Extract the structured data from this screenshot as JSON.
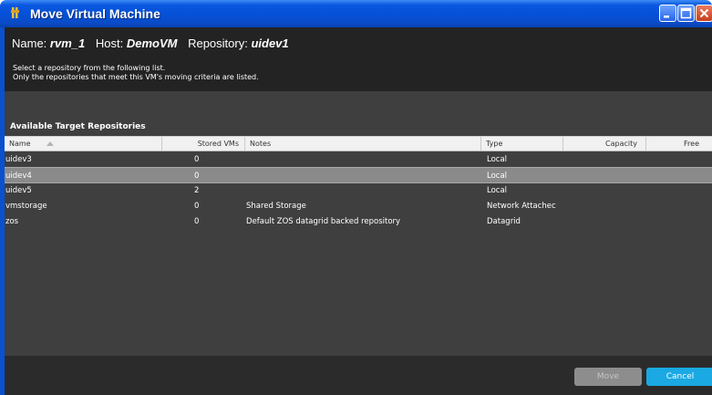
{
  "window": {
    "title": "Move Virtual Machine"
  },
  "info": {
    "name_label": "Name:",
    "name_value": "rvm_1",
    "host_label": "Host:",
    "host_value": "DemoVM",
    "repo_label": "Repository:",
    "repo_value": "uidev1",
    "instruction_1": "Select a repository from the following list.",
    "instruction_2": "Only the repositories that meet this VM's moving criteria are listed."
  },
  "section_label": "Available Target Repositories",
  "table": {
    "columns": [
      "Name",
      "Stored VMs",
      "Notes",
      "Type",
      "Capacity",
      "Free"
    ],
    "sorted_column": "Name",
    "selected_row": 1,
    "rows": [
      {
        "name": "uidev3",
        "stored": "0",
        "notes": "",
        "type": "Local"
      },
      {
        "name": "uidev4",
        "stored": "0",
        "notes": "",
        "type": "Local"
      },
      {
        "name": "uidev5",
        "stored": "2",
        "notes": "",
        "type": "Local"
      },
      {
        "name": "vmstorage",
        "stored": "0",
        "notes": "Shared Storage",
        "type": "Network Attachec"
      },
      {
        "name": "zos",
        "stored": "0",
        "notes": "Default ZOS datagrid backed repository",
        "type": "Datagrid"
      }
    ]
  },
  "buttons": {
    "move": "Move",
    "cancel": "Cancel"
  },
  "colors": {
    "accent": "#1aa9e2",
    "titlebar": "#0550d6",
    "background": "#3f3f3f"
  }
}
